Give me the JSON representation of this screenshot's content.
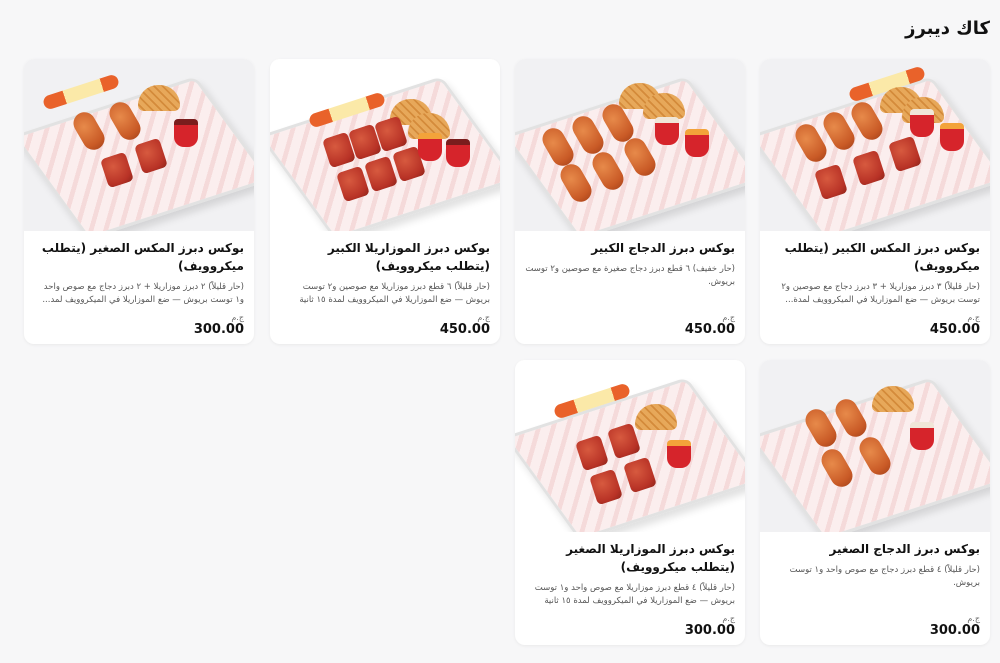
{
  "section": {
    "title": "كاك ديبرز"
  },
  "cards": [
    {
      "name": "بوكس دبرز المكس الكبير (يتطلب ميكروويف)",
      "description": "(حار قليلاً) ٣ دبرز موزاريلا + ٣ دبرز دجاج مع صوصين و٢ توست بريوش — ضع الموزاريلا في الميكروويف لمدة...",
      "currency": "ج.م",
      "price": "450.00"
    },
    {
      "name": "بوكس دبرز الدجاج الكبير",
      "description": "(حار خفيف) ٦ قطع دبرز دجاج صغيرة مع صوصين و٢ توست بريوش.",
      "currency": "ج.م",
      "price": "450.00"
    },
    {
      "name": "بوكس دبرز الموزاريلا الكبير (يتطلب ميكروويف)",
      "description": "(حار قليلاً) ٦ قطع دبرز موزاريلا مع صوصين و٢ توست بريوش — ضع الموزاريلا في الميكروويف لمدة ١٥ ثانية",
      "currency": "ج.م",
      "price": "450.00"
    },
    {
      "name": "بوكس دبرز المكس الصغير (يتطلب ميكروويف)",
      "description": "(حار قليلاً) ٢ دبرز موزاريلا + ٢ دبرز دجاج مع صوص واحد و١ توست بريوش — ضع الموزاريلا في الميكروويف لمد...",
      "currency": "ج.م",
      "price": "300.00"
    },
    {
      "name": "بوكس دبرز الدجاج الصغير",
      "description": "(حار قليلاً) ٤ قطع دبرز دجاج مع صوص واحد و١ توست بريوش.",
      "currency": "ج.م",
      "price": "300.00"
    },
    {
      "name": "بوكس دبرز الموزاريلا الصغير (يتطلب ميكروويف)",
      "description": "(حار قليلاً) ٤ قطع دبرز موزاريلا مع صوص واحد و١ توست بريوش — ضع الموزاريلا في الميكروويف لمدة ١٥ ثانية",
      "currency": "ج.م",
      "price": "300.00"
    }
  ]
}
